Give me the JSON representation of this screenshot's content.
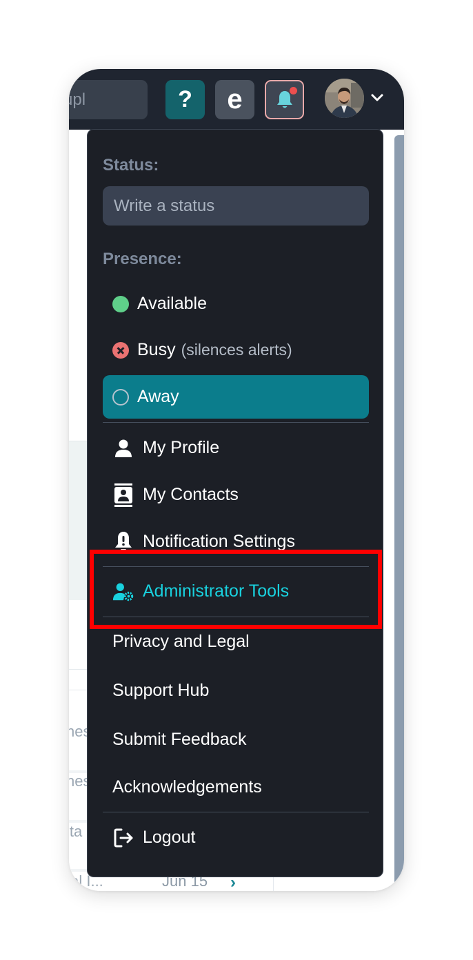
{
  "topbar": {
    "search_fragment": "upl",
    "help_label": "?",
    "e_label": "e",
    "notification_badge_color": "#ec4f4f"
  },
  "background": {
    "row_fragments": [
      "nes",
      "nes",
      "ita",
      "tal I..."
    ],
    "date": "Jun 15",
    "chevron": "›"
  },
  "menu": {
    "status_label": "Status:",
    "status_placeholder": "Write a status",
    "presence_label": "Presence:",
    "presence": [
      {
        "label": "Available",
        "sub": "",
        "state": "available"
      },
      {
        "label": "Busy",
        "sub": "(silences alerts)",
        "state": "busy"
      },
      {
        "label": "Away",
        "sub": "",
        "state": "away",
        "selected": true
      }
    ],
    "items": [
      {
        "label": "My Profile",
        "icon": "user-icon"
      },
      {
        "label": "My Contacts",
        "icon": "contacts-book-icon"
      },
      {
        "label": "Notification Settings",
        "icon": "bell-exclamation-icon"
      },
      {
        "label": "Administrator Tools",
        "icon": "user-gear-icon",
        "highlighted": true
      },
      {
        "label": "Privacy and Legal"
      },
      {
        "label": "Support Hub"
      },
      {
        "label": "Submit Feedback"
      },
      {
        "label": "Acknowledgements"
      },
      {
        "label": "Logout",
        "icon": "logout-icon"
      }
    ]
  },
  "colors": {
    "accent_teal": "#0b7d8c",
    "admin_text": "#19d1de",
    "highlight_box": "#ff0000",
    "menu_bg": "#1c1f26"
  }
}
